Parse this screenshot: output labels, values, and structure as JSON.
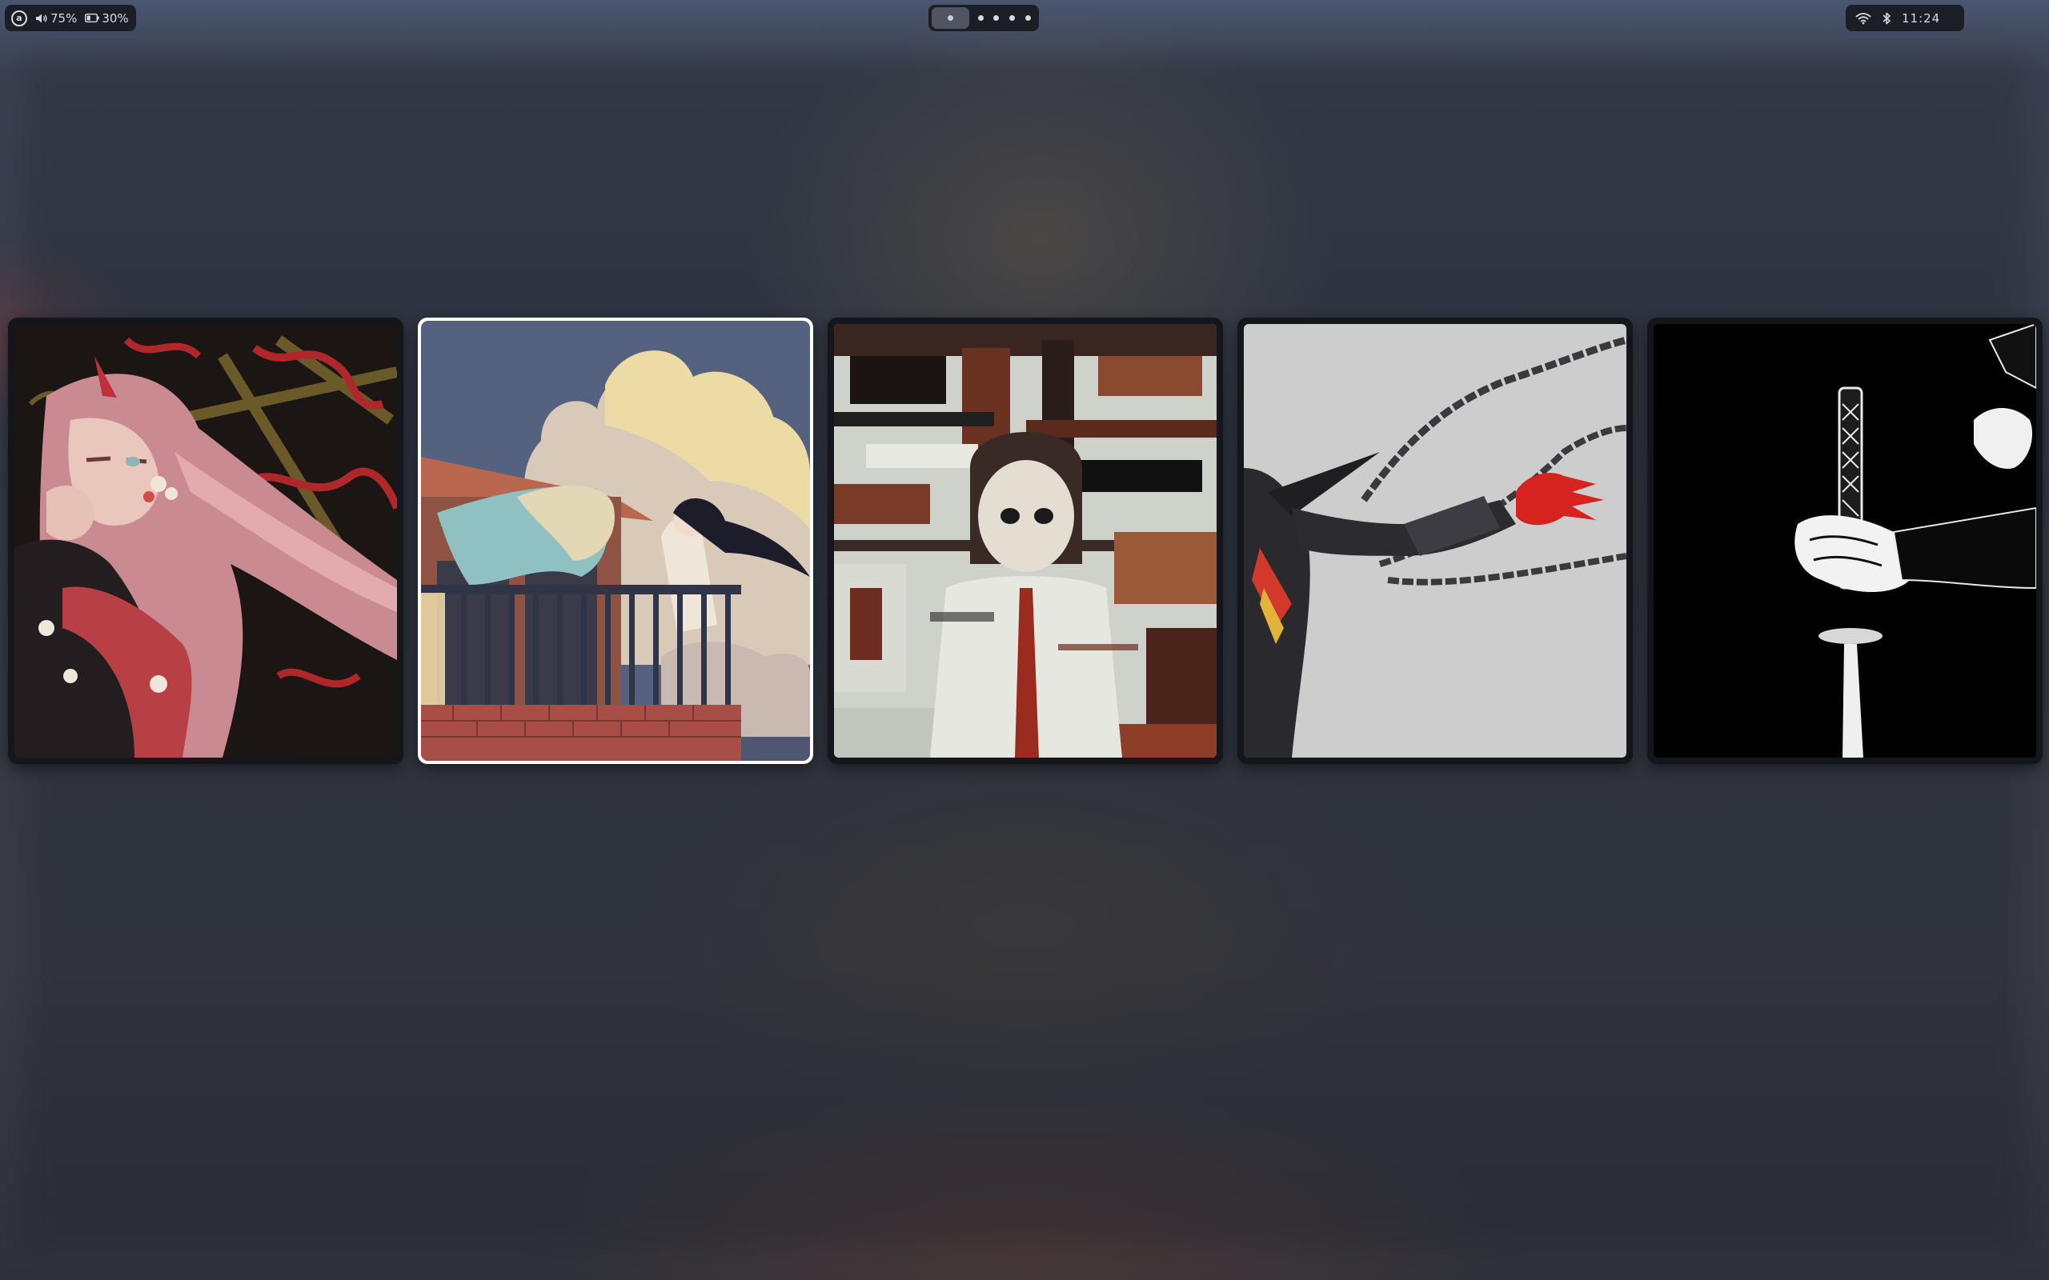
{
  "topbar": {
    "launcher_icon": "arch-icon",
    "volume": {
      "icon": "volume-icon",
      "label": "75%"
    },
    "battery": {
      "icon": "battery-icon",
      "label": "30%"
    },
    "workspaces": {
      "count": 5,
      "active": 1
    },
    "wifi_icon": "wifi-icon",
    "bluetooth_icon": "bluetooth-icon",
    "clock": "11:24"
  },
  "wallpapers": [
    {
      "id": 1,
      "subject": "oni-girl-pink-hair",
      "selected": false,
      "accent": "#c98a8e"
    },
    {
      "id": 2,
      "subject": "girl-on-balcony-clouds",
      "selected": true,
      "accent": "#5b6b8c"
    },
    {
      "id": 3,
      "subject": "glitch-art-boy-tie",
      "selected": false,
      "accent": "#7a3a28"
    },
    {
      "id": 4,
      "subject": "mecha-arm-red-claw",
      "selected": false,
      "accent": "#d12a24"
    },
    {
      "id": 5,
      "subject": "hand-gripping-katana",
      "selected": false,
      "accent": "#000000"
    }
  ],
  "colors": {
    "bar_bg": "#1c1e25",
    "bar_fg": "#d7dae2",
    "selection_border": "#ffffff"
  }
}
